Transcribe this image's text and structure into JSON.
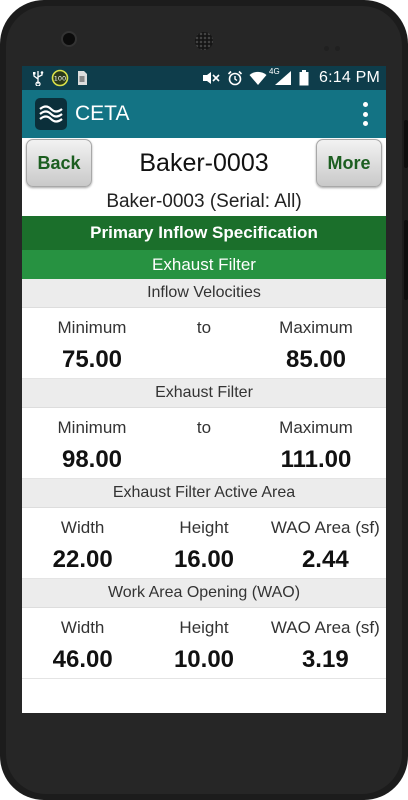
{
  "statusbar": {
    "left_icons": [
      "usb-icon",
      "battery-100-icon",
      "sd-card-icon"
    ],
    "right_icons": [
      "mute-icon",
      "alarm-clock-icon",
      "wifi-icon",
      "4g-signal-icon",
      "battery-icon"
    ],
    "network": "4G",
    "battery_badge": "100",
    "time": "6:14 PM"
  },
  "appbar": {
    "title": "CETA",
    "logo_icon": "ceta-wave-logo-icon",
    "overflow_icon": "overflow-menu-icon"
  },
  "nav": {
    "back_label": "Back",
    "title": "Baker-0003",
    "more_label": "More"
  },
  "serial_line": "Baker-0003 (Serial: All)",
  "primary_header": "Primary Inflow Specification",
  "sub_header": "Exhaust Filter",
  "sections": [
    {
      "title": "Inflow Velocities",
      "labels": [
        "Minimum",
        "to",
        "Maximum"
      ],
      "values": [
        "75.00",
        "85.00"
      ]
    },
    {
      "title": "Exhaust Filter",
      "labels": [
        "Minimum",
        "to",
        "Maximum"
      ],
      "values": [
        "98.00",
        "111.00"
      ]
    },
    {
      "title": "Exhaust Filter Active Area",
      "labels": [
        "Width",
        "Height",
        "WAO Area (sf)"
      ],
      "values": [
        "22.00",
        "16.00",
        "2.44"
      ]
    },
    {
      "title": "Work Area Opening (WAO)",
      "labels": [
        "Width",
        "Height",
        "WAO Area (sf)"
      ],
      "values": [
        "46.00",
        "10.00",
        "3.19"
      ]
    }
  ],
  "colors": {
    "statusbar": "#0e3d4b",
    "appbar": "#137384",
    "primary_header": "#1b6f2b",
    "sub_header": "#279241",
    "button_text": "#1c5e20"
  }
}
